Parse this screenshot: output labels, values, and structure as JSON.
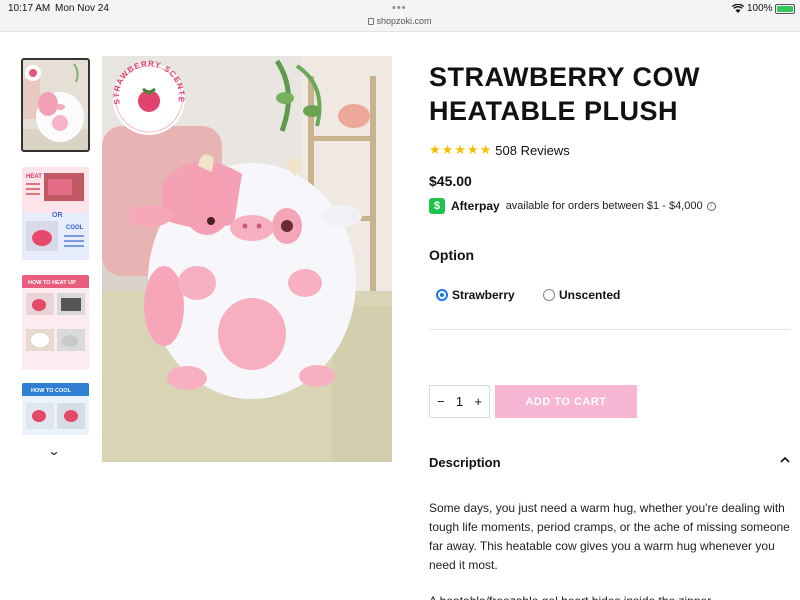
{
  "status_bar": {
    "time": "10:17 AM",
    "date": "Mon Nov 24",
    "url": "shopzoki.com",
    "battery": "100%",
    "battery_level": 1.0
  },
  "gallery": {
    "thumbnails": [
      {
        "name": "thumbnail-cow-plush",
        "selected": true
      },
      {
        "name": "thumbnail-heat-or-cool",
        "selected": false
      },
      {
        "name": "thumbnail-how-to-heat-up",
        "selected": false
      },
      {
        "name": "thumbnail-how-to-cool",
        "selected": false
      }
    ],
    "badge_text": "STRAWBERRY SCENTED",
    "thumb_texts": {
      "heat": "HEAT",
      "or": "OR",
      "cool": "COOL",
      "how_to_heat": "HOW TO HEAT UP",
      "how_to_cool": "HOW TO COOL"
    }
  },
  "product": {
    "title": "STRAWBERRY COW HEATABLE PLUSH",
    "rating": 5,
    "reviews_text": "508 Reviews",
    "price": "$45.00",
    "afterpay": {
      "name": "Afterpay",
      "text": "available for orders between $1 - $4,000"
    }
  },
  "option": {
    "heading": "Option",
    "choices": [
      {
        "label": "Strawberry",
        "selected": true
      },
      {
        "label": "Unscented",
        "selected": false
      }
    ]
  },
  "cart": {
    "minus": "−",
    "quantity": "1",
    "plus": "+",
    "add_label": "ADD TO CART"
  },
  "description": {
    "heading": "Description",
    "paragraph1": "Some days, you just need a warm hug, whether you're dealing with tough life moments, period cramps, or the ache of missing someone far away. This heatable cow gives you a warm hug whenever you need it most.",
    "paragraph2_partial": "A heatable/freezable gel heart hides inside the zipper..."
  },
  "colors": {
    "accent_pink": "#f7b6d3",
    "star": "#f2c200",
    "afterpay_green": "#1fc24a",
    "radio_blue": "#1a73e8"
  }
}
